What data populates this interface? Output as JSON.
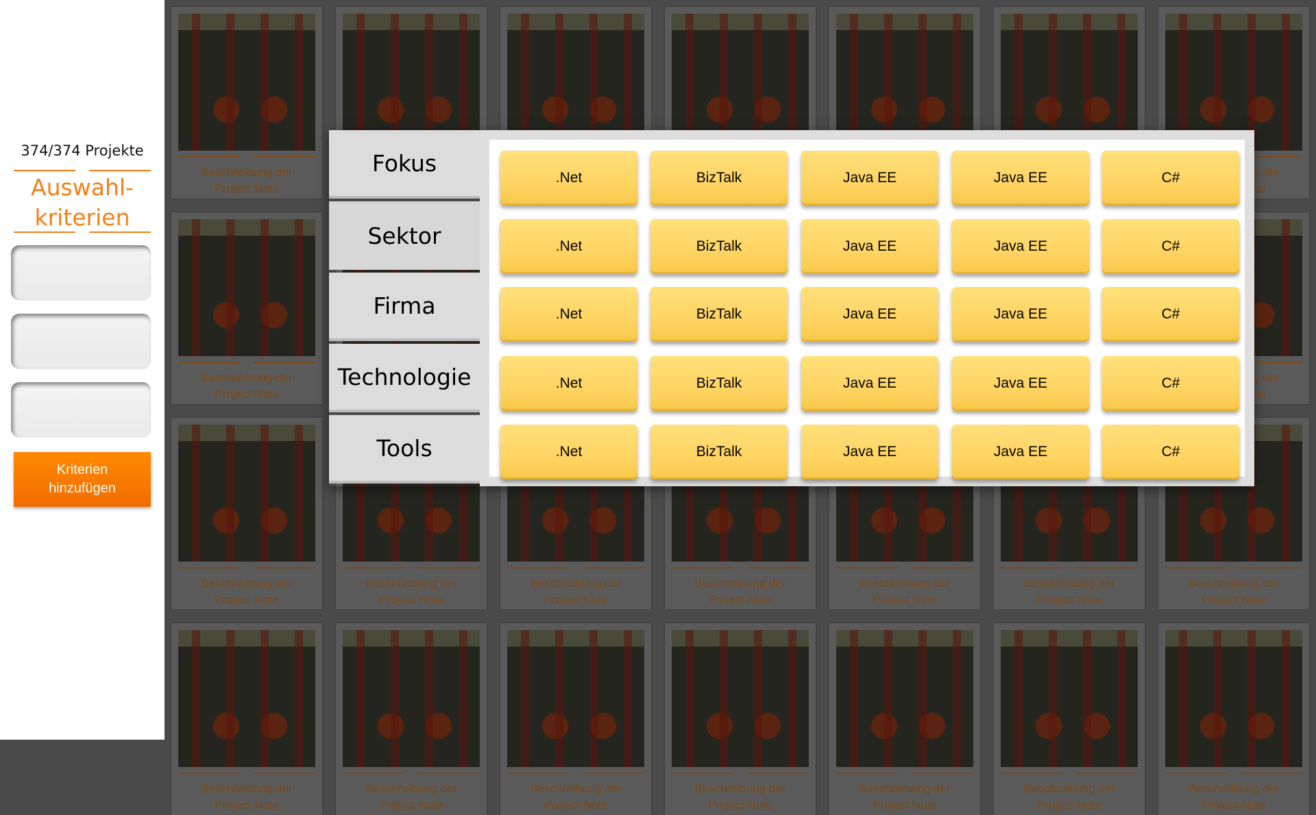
{
  "sidebar": {
    "count_label": "374/374 Projekte",
    "title_line1": "Auswahl-",
    "title_line2": "kriterien",
    "add_button_line1": "Kriterien",
    "add_button_line2": "hinzufügen",
    "criteria_slot_count": 3
  },
  "tiles": {
    "desc_line1": "Beschreibung der",
    "desc_line2": "Project Note"
  },
  "filter": {
    "tabs": [
      {
        "label": "Fokus",
        "active": false
      },
      {
        "label": "Sektor",
        "active": true
      },
      {
        "label": "Firma",
        "active": false
      },
      {
        "label": "Technologie",
        "active": false
      },
      {
        "label": "Tools",
        "active": false
      }
    ],
    "rows": [
      [
        ".Net",
        "BizTalk",
        "Java EE",
        "Java EE",
        "C#"
      ],
      [
        ".Net",
        "BizTalk",
        "Java EE",
        "Java EE",
        "C#"
      ],
      [
        ".Net",
        "BizTalk",
        "Java EE",
        "Java EE",
        "C#"
      ],
      [
        ".Net",
        "BizTalk",
        "Java EE",
        "Java EE",
        "C#"
      ],
      [
        ".Net",
        "BizTalk",
        "Java EE",
        "Java EE",
        "C#"
      ]
    ]
  },
  "colors": {
    "accent": "#f57f17",
    "button_orange": "#ff7a00",
    "option_yellow": "#ffd463",
    "tab_grey": "#dcdcdc",
    "backdrop": "#4a4a4a"
  }
}
